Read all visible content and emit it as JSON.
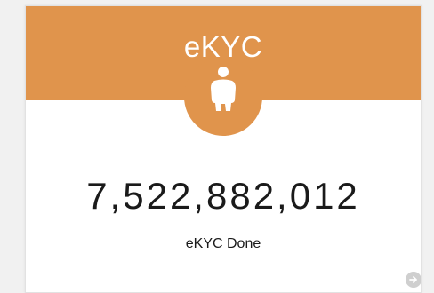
{
  "card": {
    "title": "eKYC",
    "icon": "person-icon",
    "value": "7,522,882,012",
    "label": "eKYC Done",
    "more_icon": "arrow-right-circle-icon"
  },
  "colors": {
    "header": "#e0944c",
    "text": "#1a1a1a",
    "more_icon": "#cfcfcf"
  }
}
